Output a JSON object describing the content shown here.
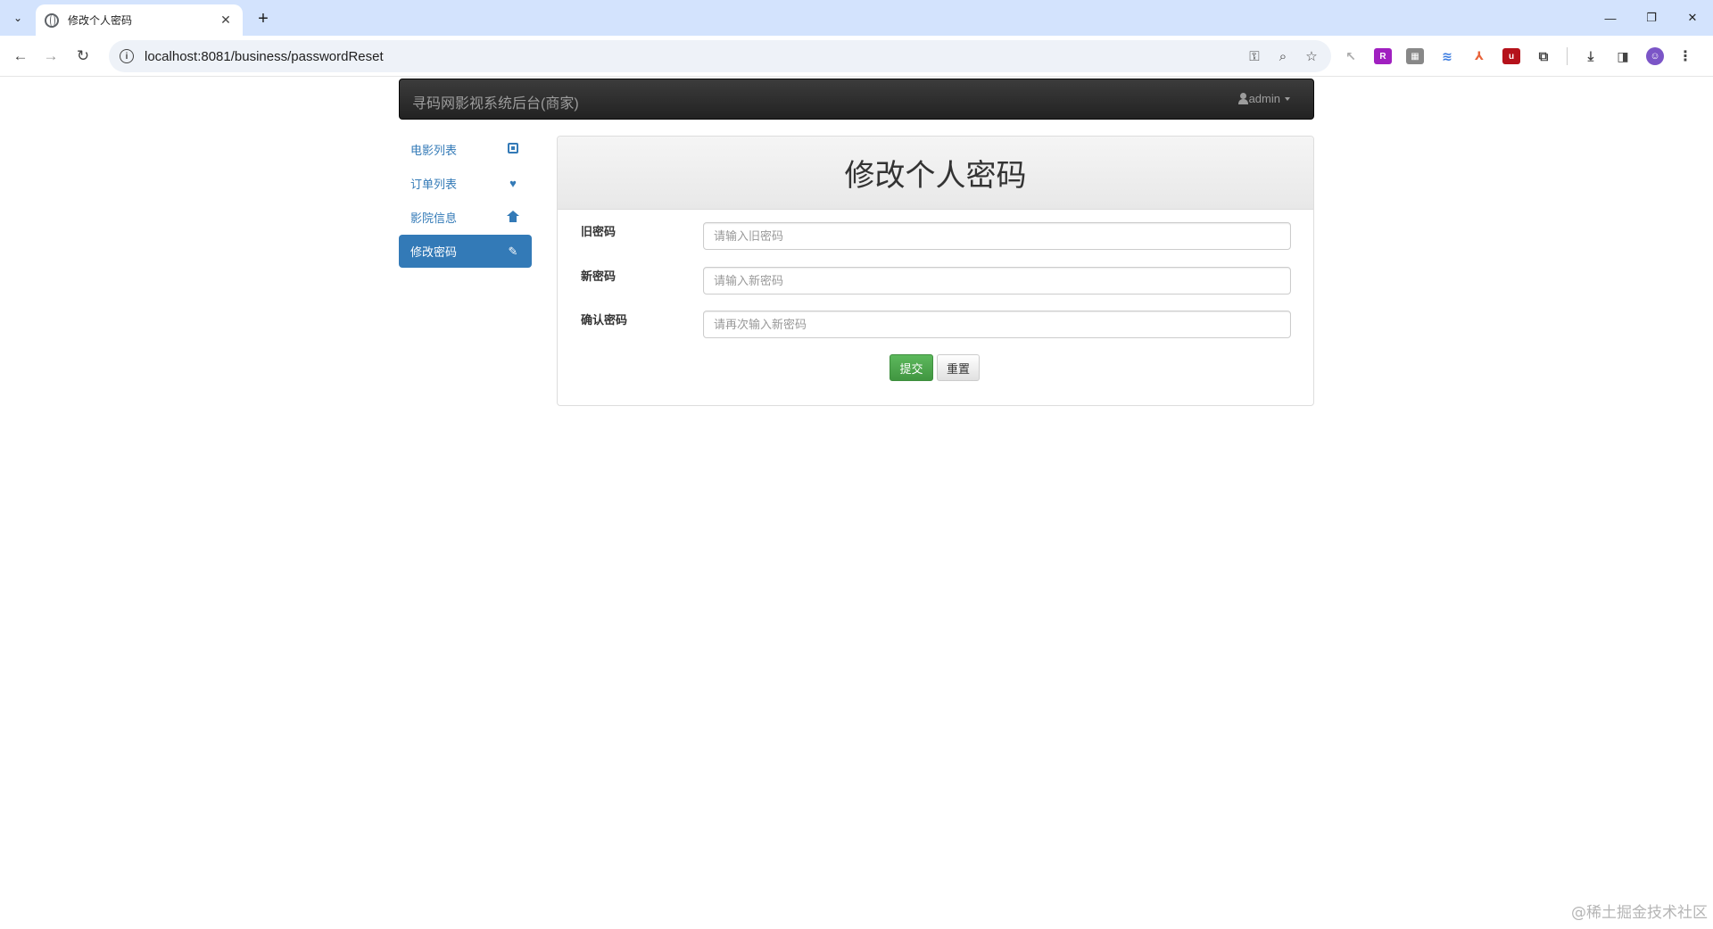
{
  "browser": {
    "tab_title": "修改个人密码",
    "tab_close": "✕",
    "new_tab": "+",
    "url": "localhost:8081/business/passwordReset",
    "window_controls": {
      "minimize": "—",
      "restore": "❐",
      "close": "✕"
    }
  },
  "navbar": {
    "brand": "寻码网影视系统后台(商家)",
    "user": "admin"
  },
  "sidebar": {
    "items": [
      {
        "label": "电影列表",
        "icon": "film-icon",
        "active": false
      },
      {
        "label": "订单列表",
        "icon": "heart-icon",
        "active": false
      },
      {
        "label": "影院信息",
        "icon": "home-icon",
        "active": false
      },
      {
        "label": "修改密码",
        "icon": "pencil-icon",
        "active": true
      }
    ]
  },
  "panel": {
    "title": "修改个人密码",
    "fields": [
      {
        "label": "旧密码",
        "placeholder": "请输入旧密码",
        "value": ""
      },
      {
        "label": "新密码",
        "placeholder": "请输入新密码",
        "value": ""
      },
      {
        "label": "确认密码",
        "placeholder": "请再次输入新密码",
        "value": ""
      }
    ],
    "submit_label": "提交",
    "reset_label": "重置"
  },
  "watermark": "@稀土掘金技术社区",
  "colors": {
    "primary": "#337ab7",
    "navbar_dark": "#222222",
    "success": "#5cb85c",
    "tabstrip": "#d3e3fd"
  }
}
